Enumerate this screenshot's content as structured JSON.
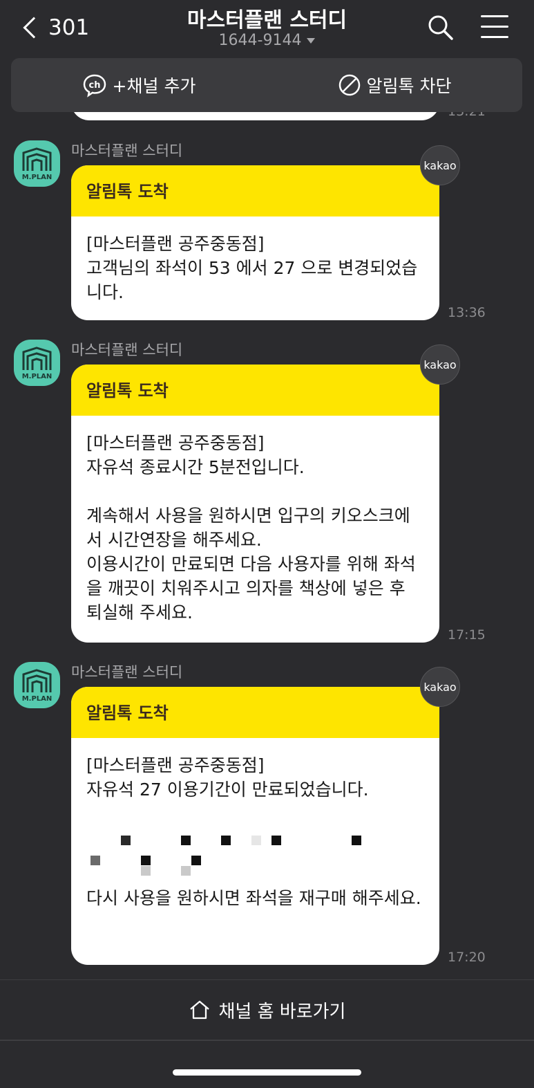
{
  "header": {
    "back_count": "301",
    "title": "마스터플랜 스터디",
    "phone": "1644-9144"
  },
  "actions": {
    "add_channel": "+채널 추가",
    "block": "알림톡 차단"
  },
  "previous_time": "13:21",
  "messages": [
    {
      "sender": "마스터플랜 스터디",
      "head": "알림톡 도착",
      "body": "[마스터플랜 공주중동점]\n고객님의 좌석이 53 에서 27 으로 변경되었습니다.",
      "badge": "kakao",
      "time": "13:36"
    },
    {
      "sender": "마스터플랜 스터디",
      "head": "알림톡 도착",
      "body": "[마스터플랜 공주중동점]\n자유석 종료시간 5분전입니다.\n\n계속해서 사용을 원하시면 입구의 키오스크에서 시간연장을 해주세요.\n이용시간이 만료되면 다음 사용자를 위해 좌석을 깨끗이 치워주시고 의자를 책상에 넣은 후 퇴실해 주세요.",
      "badge": "kakao",
      "time": "17:15"
    },
    {
      "sender": "마스터플랜 스터디",
      "head": "알림톡 도착",
      "body": "[마스터플랜 공주중동점]\n자유석 27 이용기간이 만료되었습니다.",
      "body2": "다시 사용을 원하시면 좌석을 재구매 해주세요.",
      "badge": "kakao",
      "time": "17:20"
    }
  ],
  "avatar_logo": "M.PLAN",
  "footer": {
    "home_label": "채널 홈 바로가기"
  },
  "colors": {
    "background": "#2b2b2e",
    "bubble_head": "#fee500",
    "avatar": "#55c9ae"
  },
  "icons": [
    "back-chevron-icon",
    "search-icon",
    "menu-icon",
    "channel-add-icon",
    "block-icon",
    "home-icon"
  ]
}
